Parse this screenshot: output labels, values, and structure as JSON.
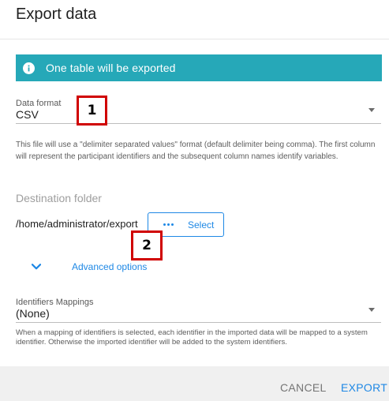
{
  "dialog": {
    "title": "Export data"
  },
  "banner": {
    "icon": "info-icon",
    "text": "One table will be exported",
    "color": "#26a8b8"
  },
  "data_format": {
    "label": "Data format",
    "value": "CSV",
    "help": "This file will use a \"delimiter separated values\" format (default delimiter being comma). The first column will represent the participant identifiers and the subsequent column names identify variables."
  },
  "destination": {
    "label": "Destination folder",
    "path": "/home/administrator/export",
    "select_label": "Select"
  },
  "advanced": {
    "label": "Advanced options"
  },
  "identifiers": {
    "label": "Identifiers Mappings",
    "value": "(None)",
    "help": "When a mapping of identifiers is selected, each identifier in the imported data will be mapped to a system identifier. Otherwise the imported identifier will be added to the system identifiers."
  },
  "callouts": {
    "one": "1",
    "two": "2"
  },
  "footer": {
    "cancel_label": "CANCEL",
    "export_label": "EXPORT"
  },
  "colors": {
    "accent": "#1e88e5",
    "annotation": "#d00000"
  }
}
